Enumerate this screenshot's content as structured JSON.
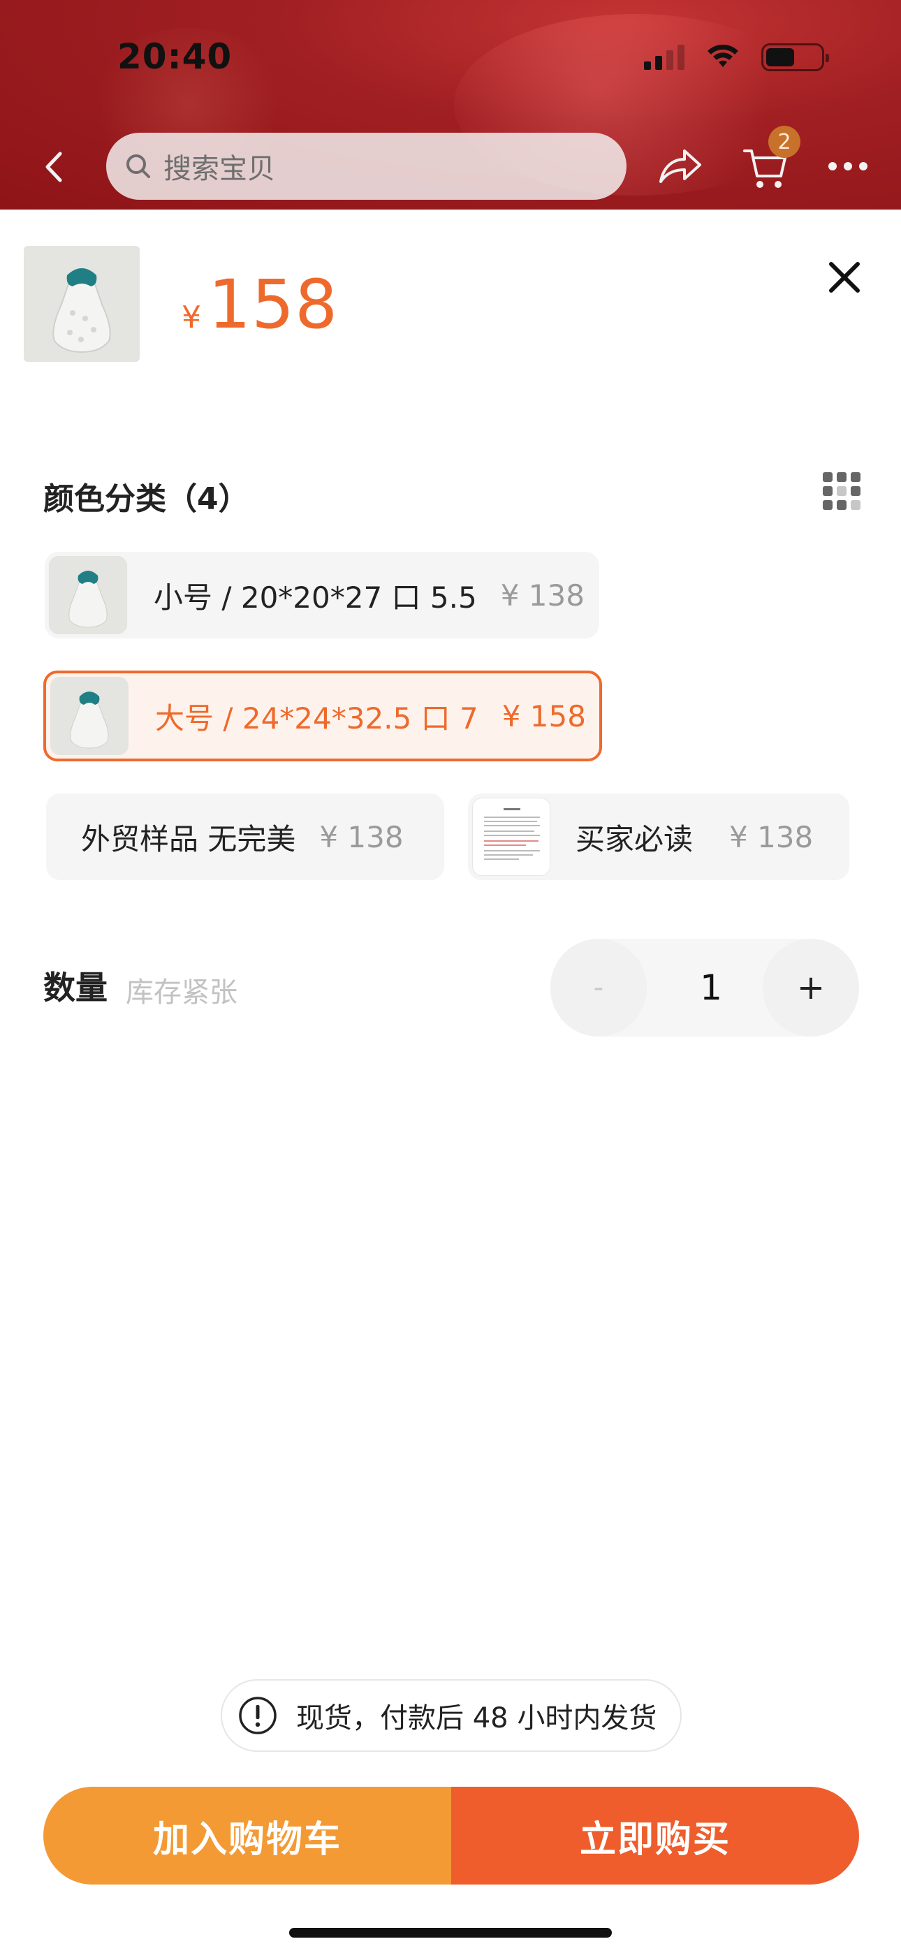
{
  "status_bar": {
    "time": "20:40"
  },
  "nav": {
    "search_placeholder": "搜索宝贝",
    "cart_badge": "2",
    "icons": [
      "back-arrow-icon",
      "search-icon",
      "share-icon",
      "cart-icon",
      "more-icon"
    ]
  },
  "product": {
    "currency": "¥",
    "price": "158"
  },
  "sku_section": {
    "title": "颜色分类（4）",
    "options": [
      {
        "name": "小号 / 20*20*27 口 5.5",
        "price": "¥ 138",
        "selected": false
      },
      {
        "name": "大号 / 24*24*32.5 口 7",
        "price": "¥ 158",
        "selected": true
      },
      {
        "name": "外贸样品 无完美",
        "price": "¥ 138",
        "selected": false
      },
      {
        "name": "买家必读",
        "price": "¥ 138",
        "selected": false
      }
    ]
  },
  "quantity": {
    "label": "数量",
    "hint": "库存紧张",
    "minus": "-",
    "value": "1",
    "plus": "+"
  },
  "notice": {
    "text": "现货，付款后 48 小时内发货"
  },
  "actions": {
    "add_to_cart": "加入购物车",
    "buy_now": "立即购买"
  },
  "colors": {
    "accent": "#ee6a2c",
    "cart_button": "#f39a35",
    "buy_button": "#ee5d2b",
    "header": "#a01f22"
  }
}
